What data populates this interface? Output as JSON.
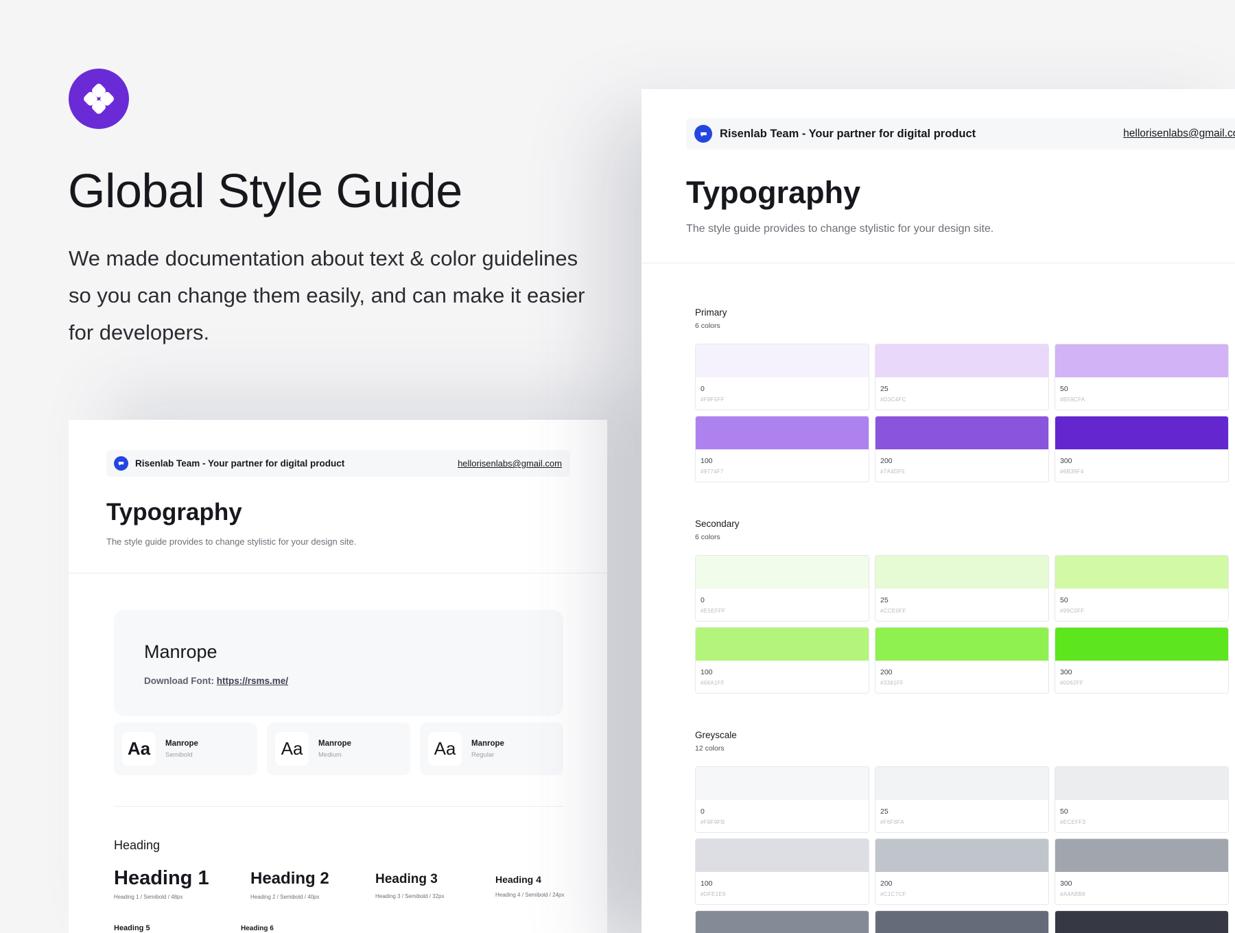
{
  "hero": {
    "title": "Global Style Guide",
    "description": "We made documentation about text & color guidelines so you can change them easily, and can make it easier for developers.",
    "logo_color": "#6a2bd6"
  },
  "topbar": {
    "team": "Risenlab Team - Your partner for digital product",
    "email": "hellorisenlabs@gmail.com",
    "badge_color": "#2446e0"
  },
  "typography": {
    "title": "Typography",
    "subtitle": "The style guide provides to change stylistic for your design site.",
    "font": {
      "name": "Manrope",
      "download_label": "Download Font:",
      "download_link": "https://rsms.me/"
    },
    "weights": [
      {
        "sample": "Aa",
        "name": "Manrope",
        "style": "Semibold"
      },
      {
        "sample": "Aa",
        "name": "Manrope",
        "style": "Medium"
      },
      {
        "sample": "Aa",
        "name": "Manrope",
        "style": "Regular"
      }
    ],
    "heading_label": "Heading",
    "headings": [
      {
        "text": "Heading 1",
        "meta": "Heading 1 / Semibold / 48px"
      },
      {
        "text": "Heading 2",
        "meta": "Heading 2 / Semibold / 40px"
      },
      {
        "text": "Heading 3",
        "meta": "Heading 3 / Semibold / 32px"
      },
      {
        "text": "Heading 4",
        "meta": "Heading 4 / Semibold / 24px"
      },
      {
        "text": "Heading 5",
        "meta": ""
      },
      {
        "text": "Heading 6",
        "meta": ""
      }
    ]
  },
  "colors": {
    "primary": {
      "title": "Primary",
      "count": "6 colors",
      "swatches": [
        {
          "name": "0",
          "hex": "#F8F5FF",
          "color": "#f6f2fd"
        },
        {
          "name": "25",
          "hex": "#D3C4FC",
          "color": "#ead8fa"
        },
        {
          "name": "50",
          "hex": "#B59CFA",
          "color": "#d2b3f5"
        },
        {
          "name": "100",
          "hex": "#9774F7",
          "color": "#ae82ee"
        },
        {
          "name": "200",
          "hex": "#7A4DF5",
          "color": "#8a54dc"
        },
        {
          "name": "300",
          "hex": "#6B39F4",
          "color": "#6427cf"
        }
      ]
    },
    "secondary": {
      "title": "Secondary",
      "count": "6 colors",
      "swatches": [
        {
          "name": "0",
          "hex": "#E5EFFF",
          "color": "#f1fdea"
        },
        {
          "name": "25",
          "hex": "#CCE0FF",
          "color": "#e6fbd3"
        },
        {
          "name": "50",
          "hex": "#99C0FF",
          "color": "#d2f9a5"
        },
        {
          "name": "100",
          "hex": "#66A1FF",
          "color": "#b2f57a"
        },
        {
          "name": "200",
          "hex": "#3381FF",
          "color": "#8ef150"
        },
        {
          "name": "300",
          "hex": "#0062FF",
          "color": "#5de51e"
        }
      ]
    },
    "greyscale": {
      "title": "Greyscale",
      "count": "12 colors",
      "swatches": [
        {
          "name": "0",
          "hex": "#F8F9FB",
          "color": "#f6f7f8"
        },
        {
          "name": "25",
          "hex": "#F6F8FA",
          "color": "#f2f3f5"
        },
        {
          "name": "50",
          "hex": "#ECEFF3",
          "color": "#ebedef"
        },
        {
          "name": "100",
          "hex": "#DFE1E6",
          "color": "#dcdee3"
        },
        {
          "name": "200",
          "hex": "#C1C7CF",
          "color": "#c0c4cb"
        },
        {
          "name": "300",
          "hex": "#A4ABB8",
          "color": "#a1a6ae"
        },
        {
          "name": "",
          "hex": "",
          "color": "#848a96"
        },
        {
          "name": "",
          "hex": "",
          "color": "#666b79"
        },
        {
          "name": "",
          "hex": "",
          "color": "#363944"
        }
      ]
    }
  }
}
